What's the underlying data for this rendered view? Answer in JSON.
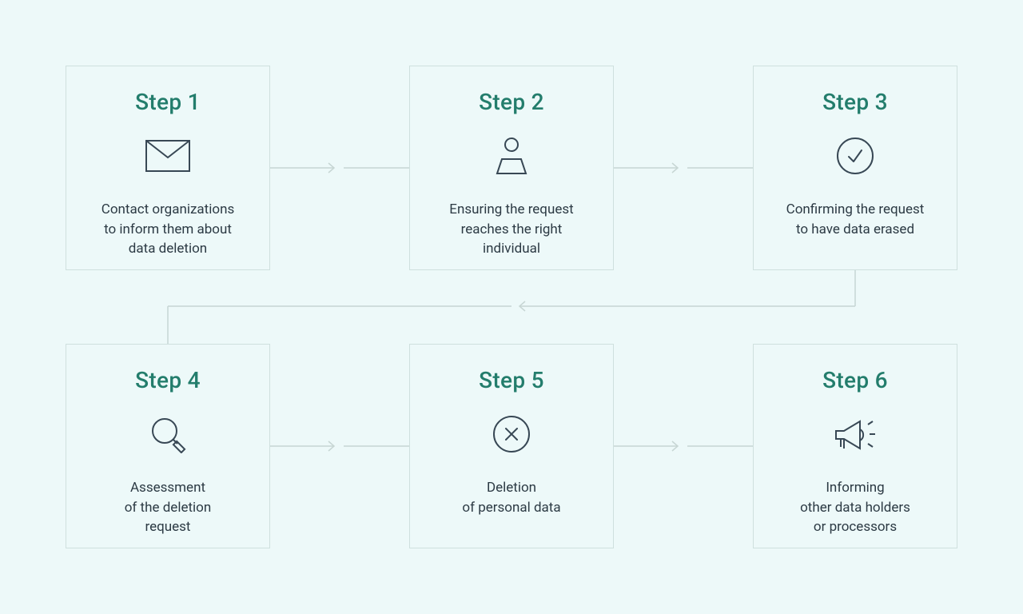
{
  "colors": {
    "bg": "#edf9f9",
    "cardBorder": "#cfe0de",
    "title": "#237d6c",
    "desc": "#2c3a44",
    "iconStroke": "#384855",
    "arrow": "#c7d6d4"
  },
  "steps": [
    {
      "title": "Step 1",
      "icon": "envelope",
      "desc": "Contact organizations\nto inform them about\ndata deletion"
    },
    {
      "title": "Step 2",
      "icon": "person",
      "desc": "Ensuring the request\nreaches the right\nindividual"
    },
    {
      "title": "Step 3",
      "icon": "check-circle",
      "desc": "Confirming the request\nto have data erased"
    },
    {
      "title": "Step 4",
      "icon": "magnifier",
      "desc": "Assessment\nof the deletion\nrequest"
    },
    {
      "title": "Step 5",
      "icon": "x-circle",
      "desc": "Deletion\nof personal data"
    },
    {
      "title": "Step 6",
      "icon": "megaphone",
      "desc": "Informing\nother data holders\nor processors"
    }
  ]
}
